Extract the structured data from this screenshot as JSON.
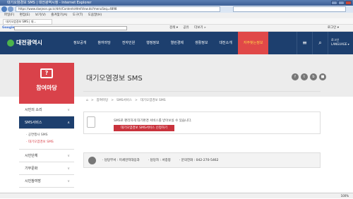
{
  "browser": {
    "title": "대기오염경보 SMS | 대전광역시청 - Internet Explorer",
    "url": "https://www.daejeon.go.kr/drh/ContentsHtmlView.do?menuSeq=4898",
    "menu": [
      "파일(F)",
      "편집(E)",
      "보기(V)",
      "즐겨찾기(A)",
      "도구(T)",
      "도움말(H)"
    ],
    "tab_label": "대기오염경보 SMS | 대...",
    "google_label": "Google",
    "google_items": [
      "검색 ▾",
      "공유",
      "더보기 »"
    ],
    "google_right": "로그인 ▾",
    "zoom": "100%"
  },
  "site": {
    "logo": "대전광역시",
    "nav": [
      "정보공개",
      "참여마당",
      "전자민원",
      "행정정보",
      "열린경제",
      "생활정보",
      "대전소개",
      "자주찾는정보"
    ],
    "login": "로그인",
    "language": "LANGUAGE ▾",
    "menu_icon": "≡",
    "search_icon": "⌕"
  },
  "sidebar": {
    "hero_icon": "?",
    "hero_title": "참여마당",
    "items": [
      {
        "label": "시민의 소리",
        "chev": "∨"
      },
      {
        "label": "SMS서비스",
        "chev": "∧"
      },
      {
        "label": "시민단체",
        "chev": "∨"
      },
      {
        "label": "기부문화",
        "chev": "∨"
      },
      {
        "label": "시민참여방",
        "chev": "∨"
      }
    ],
    "sub_items": [
      "· 공연행사 SMS",
      "· 대기오염경보 SMS"
    ]
  },
  "main": {
    "title": "대기오염경보 SMS",
    "social": [
      "f",
      "t",
      "b",
      "■"
    ],
    "breadcrumb": [
      "⌂",
      ">",
      "참여마당",
      ">",
      "SMS서비스",
      ">",
      "대기오염경보 SMS"
    ],
    "sms_desc": "SMS로 편리하게 대기환경 서비스를 받아보실 수 있습니다.",
    "sms_button": "대기오염경보 SMS서비스 신청하기",
    "contact": {
      "dept": "· 담당부서 : 미세먼지대응과",
      "person": "· 담당자 : 서종봉",
      "phone": "· 문의전화 : 042-270-5462"
    }
  }
}
